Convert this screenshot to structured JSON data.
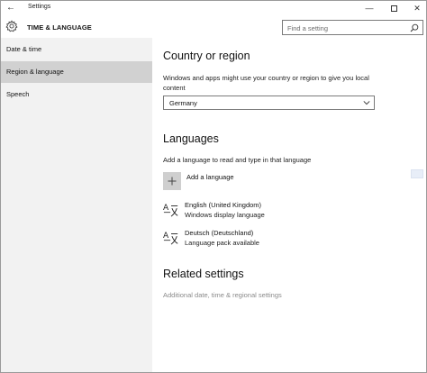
{
  "window": {
    "title": "Settings",
    "back_glyph": "←",
    "minimize_glyph": "—",
    "close_glyph": "✕"
  },
  "header": {
    "section_title": "TIME & LANGUAGE",
    "search_placeholder": "Find a setting"
  },
  "sidebar": {
    "items": [
      {
        "label": "Date & time",
        "selected": false
      },
      {
        "label": "Region & language",
        "selected": true
      },
      {
        "label": "Speech",
        "selected": false
      }
    ]
  },
  "main": {
    "country_heading": "Country or region",
    "country_desc": "Windows and apps might use your country or region to give you local content",
    "country_value": "Germany",
    "languages_heading": "Languages",
    "languages_desc": "Add a language to read and type in that language",
    "add_language_label": "Add a language",
    "languages": [
      {
        "name": "English (United Kingdom)",
        "status": "Windows display language"
      },
      {
        "name": "Deutsch (Deutschland)",
        "status": "Language pack available"
      }
    ],
    "related_heading": "Related settings",
    "related_link": "Additional date, time & regional settings"
  },
  "colors": {
    "sidebar_bg": "#f2f2f2",
    "selected_bg": "#d1d1d1",
    "link_gray": "#8a8a8a"
  },
  "icons": {
    "back": "back-arrow-icon",
    "gear": "gear-icon",
    "search": "search-icon",
    "dropdown": "chevron-down-icon",
    "add": "plus-icon",
    "language": "language-glyph-icon"
  }
}
